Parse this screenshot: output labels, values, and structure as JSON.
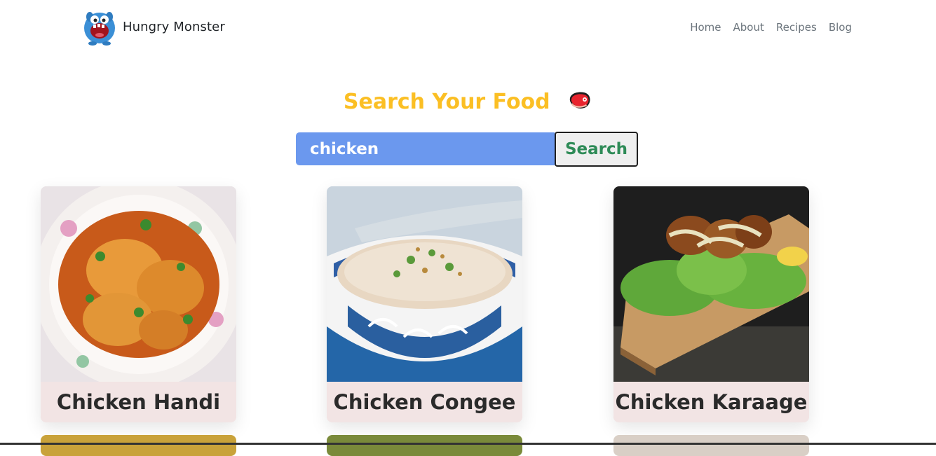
{
  "brand": {
    "name": "Hungry Monster",
    "logo_icon": "monster-logo-icon"
  },
  "nav": {
    "items": [
      "Home",
      "About",
      "Recipes",
      "Blog"
    ]
  },
  "hero": {
    "title": "Search Your Food",
    "icon": "meat-icon",
    "title_color": "#fbbf24"
  },
  "search": {
    "value": "chicken",
    "button_label": "Search",
    "input_color": "#6b98ee",
    "button_text_color": "#2e8b57"
  },
  "meals": [
    {
      "name": "Chicken Handi",
      "image": "chicken-handi-image"
    },
    {
      "name": "Chicken Congee",
      "image": "chicken-congee-image"
    },
    {
      "name": "Chicken Karaage",
      "image": "chicken-karaage-image"
    }
  ]
}
